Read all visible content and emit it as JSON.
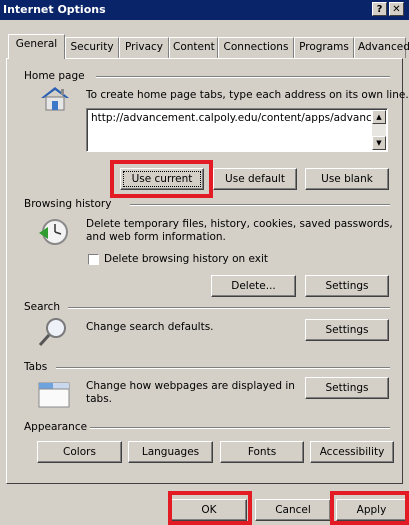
{
  "window": {
    "title": "Internet Options",
    "help_glyph": "?",
    "close_glyph": "✕"
  },
  "tabs": [
    "General",
    "Security",
    "Privacy",
    "Content",
    "Connections",
    "Programs",
    "Advanced"
  ],
  "active_tab": "General",
  "home_page": {
    "heading": "Home page",
    "instruction": "To create home page tabs, type each address on its own line.",
    "url": "http://advancement.calpoly.edu/content/apps/advancement",
    "use_current": "Use current",
    "use_default": "Use default",
    "use_blank": "Use blank",
    "icon": "house-icon"
  },
  "browsing_history": {
    "heading": "Browsing history",
    "desc_line1": "Delete temporary files, history, cookies, saved passwords,",
    "desc_line2": "and web form information.",
    "checkbox_label": "Delete browsing history on exit",
    "checkbox_checked": false,
    "delete_btn": "Delete...",
    "settings_btn": "Settings",
    "icon": "history-clock-icon"
  },
  "search": {
    "heading": "Search",
    "desc": "Change search defaults.",
    "settings_btn": "Settings",
    "icon": "magnifier-icon"
  },
  "tabs_section": {
    "heading": "Tabs",
    "desc_line1": "Change how webpages are displayed in",
    "desc_line2": "tabs.",
    "settings_btn": "Settings",
    "icon": "tabbed-window-icon"
  },
  "appearance": {
    "heading": "Appearance",
    "colors": "Colors",
    "languages": "Languages",
    "fonts": "Fonts",
    "accessibility": "Accessibility"
  },
  "footer": {
    "ok": "OK",
    "cancel": "Cancel",
    "apply": "Apply"
  },
  "colors": {
    "titlebar": "#0a246a",
    "dialog": "#d4d0c8",
    "highlight_box": "#e21b24"
  }
}
